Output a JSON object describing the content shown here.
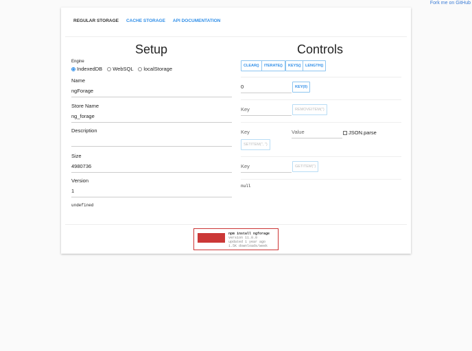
{
  "fork_link": "Fork me on GitHub",
  "tabs": [
    "REGULAR STORAGE",
    "CACHE STORAGE",
    "API DOCUMENTATION"
  ],
  "setup": {
    "title": "Setup",
    "engine_label": "Engine",
    "engines": [
      "IndexedDB",
      "WebSQL",
      "localStorage"
    ],
    "selected_engine": "IndexedDB",
    "name_label": "Name",
    "name_value": "ngForage",
    "store_label": "Store Name",
    "store_value": "ng_forage",
    "desc_label": "Description",
    "desc_value": "",
    "size_label": "Size",
    "size_value": "4980736",
    "version_label": "Version",
    "version_value": "1",
    "output": "undefined"
  },
  "controls": {
    "title": "Controls",
    "buttons": [
      "CLEAR()",
      "ITERATE()",
      "KEYS()",
      "LENGTH()"
    ],
    "key_index": "0",
    "key_button": "KEY(0)",
    "remove_placeholder": "Key",
    "remove_button": "REMOVEITEM('')",
    "set_key_placeholder": "Key",
    "set_value_placeholder": "Value",
    "json_parse": "JSON.parse",
    "set_button": "SETITEM('', '')",
    "get_placeholder": "Key",
    "get_button": "GETITEM('')",
    "output": "null"
  },
  "npm": {
    "command": "npm install ngforage",
    "version": "version 11.0.0",
    "updated": "updated 1 year ago",
    "downloads": "1.5K downloads/week"
  }
}
